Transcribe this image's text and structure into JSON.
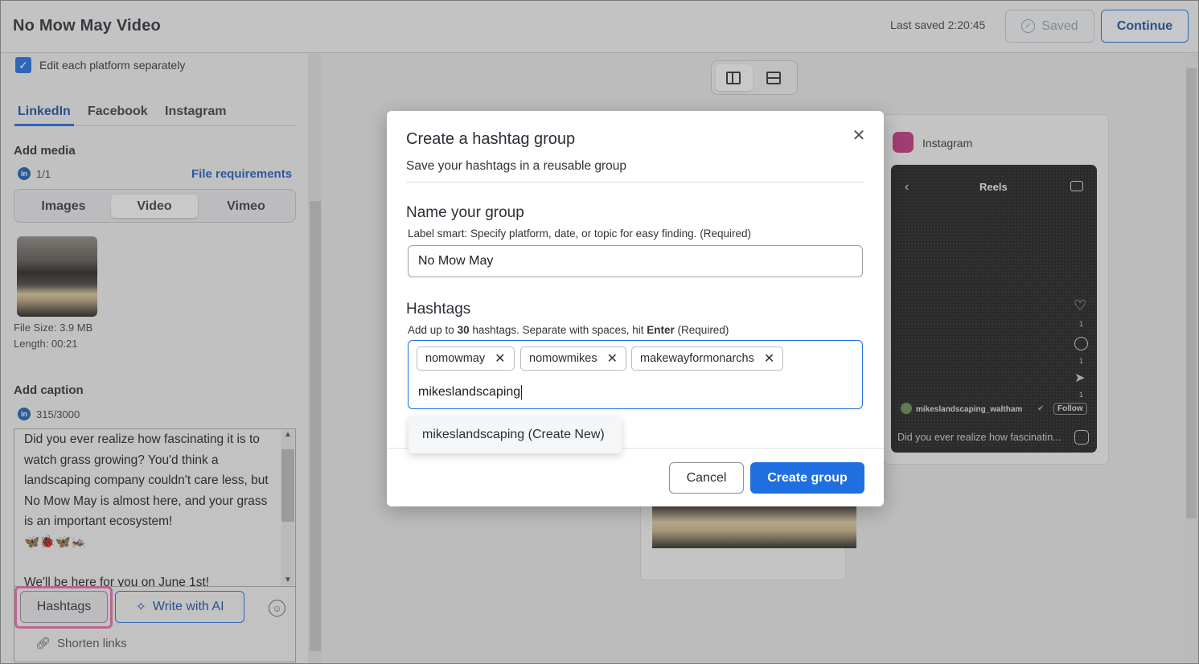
{
  "header": {
    "title": "No Mow May Video",
    "last_saved": "Last saved 2:20:45",
    "saved_label": "Saved",
    "continue_label": "Continue"
  },
  "left": {
    "edit_separately": "Edit each platform separately",
    "tabs": [
      "LinkedIn",
      "Facebook",
      "Instagram"
    ],
    "add_media": "Add media",
    "media_count": "1/1",
    "file_requirements": "File requirements",
    "media_types": [
      "Images",
      "Video",
      "Vimeo"
    ],
    "file_size": "File Size: 3.9 MB",
    "length": "Length: 00:21",
    "add_caption": "Add caption",
    "caption_count": "315/3000",
    "caption_text": "Did you ever realize how fascinating it is to watch grass growing? You'd think a landscaping company couldn't care less, but No Mow May is almost here, and your grass is an important ecosystem!",
    "caption_emojis": "🦋🐞🦋🦗",
    "caption_text2": "We'll be here for you on June 1st!",
    "hashtags_label": "Hashtags",
    "write_ai_label": "Write with AI",
    "shorten_links": "Shorten links"
  },
  "preview": {
    "instagram_label": "Instagram",
    "reels_title": "Reels",
    "username": "mikeslandscaping_waltham",
    "follow": "Follow",
    "caption": "Did you ever realize how fascinatin...",
    "counts": [
      "1",
      "1",
      "1"
    ]
  },
  "modal": {
    "title": "Create a hashtag group",
    "subtitle": "Save your hashtags in a reusable group",
    "name_heading": "Name your group",
    "name_help": "Label smart: Specify platform, date, or topic for easy finding.",
    "required": "(Required)",
    "name_value": "No Mow May",
    "hashtags_heading": "Hashtags",
    "hashtags_help_prefix": "Add up to",
    "hashtags_help_max": "30",
    "hashtags_help_mid": "hashtags. Separate with spaces, hit",
    "hashtags_help_key": "Enter",
    "chips": [
      "nomowmay",
      "nomowmikes",
      "makewayformonarchs"
    ],
    "typed_value": "mikeslandscaping",
    "suggestion": "mikeslandscaping (Create New)",
    "cancel_label": "Cancel",
    "create_label": "Create group"
  },
  "colors": {
    "accent": "#1f6fe0",
    "highlight": "#e96bb2"
  }
}
